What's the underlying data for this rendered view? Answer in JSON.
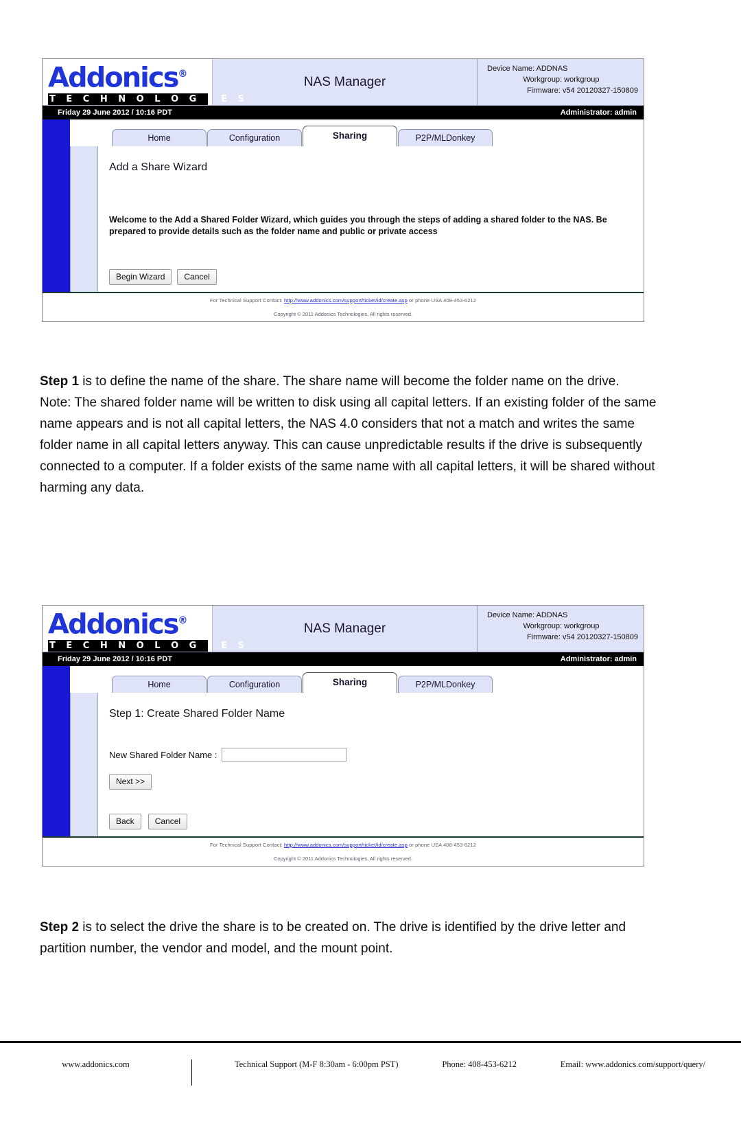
{
  "brand": {
    "logo_text": "Addonics",
    "logo_reg": "®",
    "logo_sub": "T E C H N O L O G I E S",
    "accent_blue": "#1f35d8",
    "sidebar_blue": "#1717d4",
    "tab_bg": "#dfe3f7"
  },
  "panel1": {
    "app_title": "NAS Manager",
    "device_name": "Device Name: ADDNAS",
    "workgroup": "Workgroup: workgroup",
    "firmware": "Firmware: v54 20120327-150809",
    "datetime": "Friday 29 June 2012 / 10:16 PDT",
    "admin": "Administrator: admin",
    "tabs": [
      {
        "label": "Home",
        "active": false
      },
      {
        "label": "Configuration",
        "active": false
      },
      {
        "label": "Sharing",
        "active": true
      },
      {
        "label": "P2P/MLDonkey",
        "active": false
      }
    ],
    "wizard_title": "Add a Share Wizard",
    "wizard_text": "Welcome to the Add a Shared Folder Wizard, which guides you through the steps of adding a shared folder to the NAS. Be prepared to provide details such as the folder name and public or private access",
    "begin_button": "Begin Wizard",
    "cancel_button": "Cancel",
    "support_prefix": "For Technical Support Contact: ",
    "support_link": "http://www.addonics.com/support/ticket/id/create.asp",
    "support_suffix": " or phone USA 408-453-6212",
    "copyright": "Copyright © 2011 Addonics Technologies, All rights reserved."
  },
  "panel2": {
    "app_title": "NAS Manager",
    "device_name": "Device Name: ADDNAS",
    "workgroup": "Workgroup: workgroup",
    "firmware": "Firmware: v54 20120327-150809",
    "datetime": "Friday 29 June 2012 / 10:16 PDT",
    "admin": "Administrator: admin",
    "tabs": [
      {
        "label": "Home",
        "active": false
      },
      {
        "label": "Configuration",
        "active": false
      },
      {
        "label": "Sharing",
        "active": true
      },
      {
        "label": "P2P/MLDonkey",
        "active": false
      }
    ],
    "step_title": "Step 1: Create Shared Folder Name",
    "field_label": "New Shared Folder Name :",
    "field_value": "",
    "field_placeholder": "",
    "next_button": "Next >>",
    "back_button": "Back",
    "cancel_button": "Cancel",
    "support_prefix": "For Technical Support Contact: ",
    "support_link": "http://www.addonics.com/support/ticket/id/create.asp",
    "support_suffix": " or phone USA 408-453-6212",
    "copyright": "Copyright © 2011 Addonics Technologies, All rights reserved."
  },
  "prose": {
    "step1_lead": "Step 1",
    "step1_body": " is to define the name of the share. The share name will become the folder name on the drive.",
    "step1_note": "Note: The shared folder name will be written to disk using all capital letters. If an existing folder of the same name appears and is not all capital letters, the NAS 4.0 considers that not a match and writes the same folder name in all capital letters anyway. This can cause unpredictable results if the drive is subsequently connected to a computer. If a folder exists of the same name with all capital letters, it will be shared without harming any data.",
    "step2_lead": "Step 2",
    "step2_body": " is to select the drive the share is to be created on. The drive is identified by the drive letter and partition number, the vendor and model, and the mount point."
  },
  "page_footer": {
    "website": "www.addonics.com",
    "support_hours": "Technical Support (M-F 8:30am - 6:00pm PST)",
    "phone": "Phone: 408-453-6212",
    "email": "Email: www.addonics.com/support/query/"
  }
}
